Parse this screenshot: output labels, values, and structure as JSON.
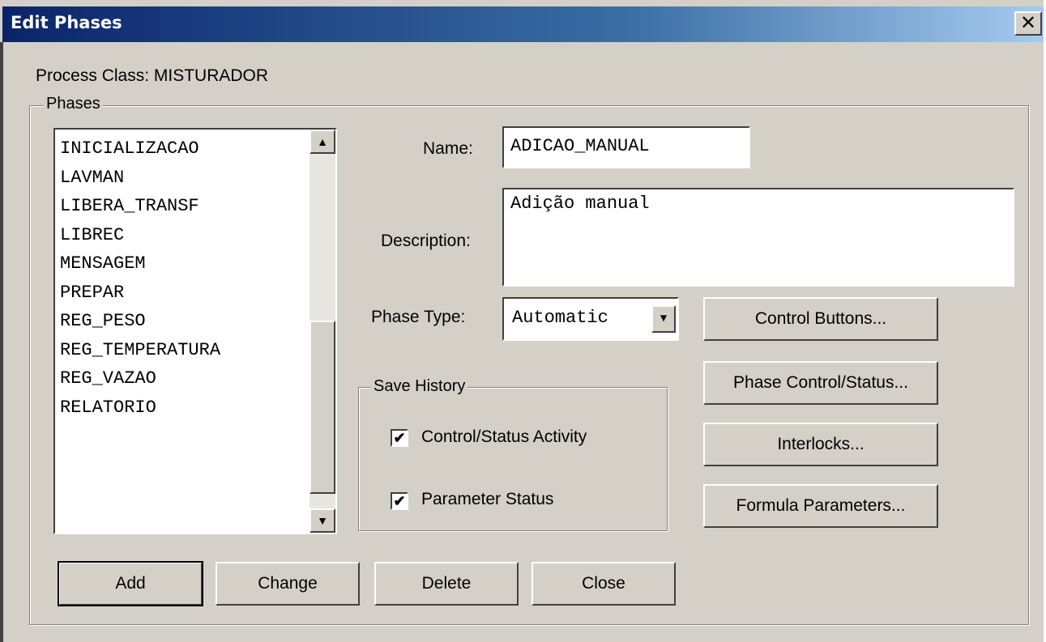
{
  "window": {
    "title": "Edit Phases",
    "close_glyph": "✕"
  },
  "process_class": "Process Class: MISTURADOR",
  "phases_group": {
    "label": "Phases",
    "list": [
      "INICIALIZACAO",
      "LAVMAN",
      "LIBERA_TRANSF",
      "LIBREC",
      "MENSAGEM",
      "PREPAR",
      "REG_PESO",
      "REG_TEMPERATURA",
      "REG_VAZAO",
      "RELATORIO"
    ],
    "scroll_up_glyph": "▲",
    "scroll_down_glyph": "▼"
  },
  "form": {
    "name_label": "Name:",
    "name_value": "ADICAO_MANUAL",
    "description_label": "Description:",
    "description_value": "Adição manual",
    "phase_type_label": "Phase Type:",
    "phase_type_value": "Automatic",
    "dropdown_glyph": "▼"
  },
  "save_history": {
    "label": "Save History",
    "check_glyph": "✔",
    "options": [
      {
        "label": "Control/Status Activity",
        "checked": true
      },
      {
        "label": "Parameter Status",
        "checked": true
      }
    ]
  },
  "side_buttons": {
    "control_buttons": "Control Buttons...",
    "phase_control_status": "Phase Control/Status...",
    "interlocks": "Interlocks...",
    "formula_parameters": "Formula Parameters..."
  },
  "bottom_buttons": {
    "add": "Add",
    "change": "Change",
    "delete": "Delete",
    "close": "Close"
  },
  "colors": {
    "face": "#d4d0c8",
    "title_start": "#0a246a",
    "title_end": "#a6caf0"
  }
}
